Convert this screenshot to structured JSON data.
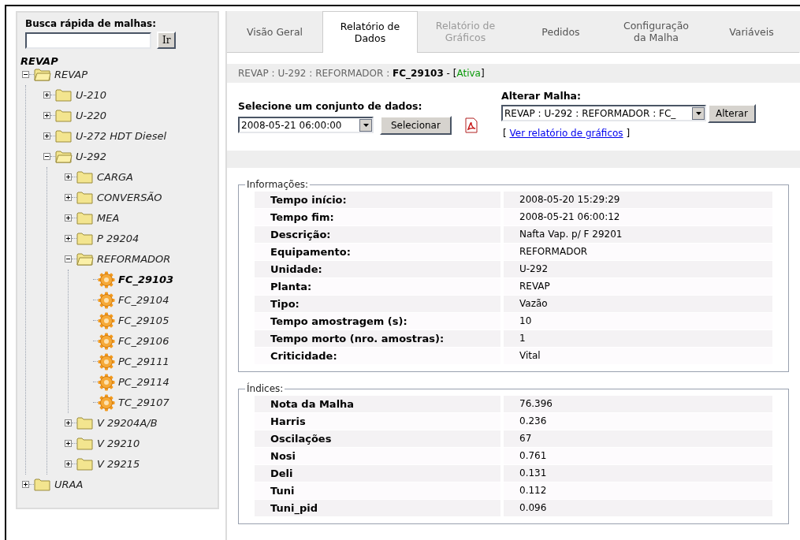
{
  "search": {
    "label": "Busca rápida de malhas:",
    "button": "Ir"
  },
  "tree": {
    "title": "REVAP",
    "items": [
      {
        "label": "REVAP",
        "kind": "folder",
        "expanded": true,
        "selected": false,
        "children": [
          {
            "label": "U-210",
            "kind": "folder",
            "expanded": false,
            "selected": false
          },
          {
            "label": "U-220",
            "kind": "folder",
            "expanded": false,
            "selected": false
          },
          {
            "label": "U-272 HDT Diesel",
            "kind": "folder",
            "expanded": false,
            "selected": false
          },
          {
            "label": "U-292",
            "kind": "folder",
            "expanded": true,
            "selected": false,
            "children": [
              {
                "label": "CARGA",
                "kind": "folder",
                "expanded": false,
                "selected": false
              },
              {
                "label": "CONVERSÃO",
                "kind": "folder",
                "expanded": false,
                "selected": false
              },
              {
                "label": "MEA",
                "kind": "folder",
                "expanded": false,
                "selected": false
              },
              {
                "label": "P 29204",
                "kind": "folder",
                "expanded": false,
                "selected": false
              },
              {
                "label": "REFORMADOR",
                "kind": "folder",
                "expanded": true,
                "selected": false,
                "children": [
                  {
                    "label": "FC_29103",
                    "kind": "loop",
                    "selected": true
                  },
                  {
                    "label": "FC_29104",
                    "kind": "loop",
                    "selected": false
                  },
                  {
                    "label": "FC_29105",
                    "kind": "loop",
                    "selected": false
                  },
                  {
                    "label": "FC_29106",
                    "kind": "loop",
                    "selected": false
                  },
                  {
                    "label": "PC_29111",
                    "kind": "loop",
                    "selected": false
                  },
                  {
                    "label": "PC_29114",
                    "kind": "loop",
                    "selected": false
                  },
                  {
                    "label": "TC_29107",
                    "kind": "loop",
                    "selected": false
                  }
                ]
              },
              {
                "label": "V 29204A/B",
                "kind": "folder",
                "expanded": false,
                "selected": false
              },
              {
                "label": "V 29210",
                "kind": "folder",
                "expanded": false,
                "selected": false
              },
              {
                "label": "V 29215",
                "kind": "folder",
                "expanded": false,
                "selected": false
              }
            ]
          }
        ]
      },
      {
        "label": "URAA",
        "kind": "folder",
        "expanded": false,
        "selected": false
      }
    ]
  },
  "tabs": [
    {
      "label": "Visão Geral",
      "selected": false,
      "disabled": false
    },
    {
      "label": "Relatório de Dados",
      "selected": true,
      "disabled": false
    },
    {
      "label": "Relatório de Gráficos",
      "selected": false,
      "disabled": true
    },
    {
      "label": "Pedidos",
      "selected": false,
      "disabled": false
    },
    {
      "label": "Configuração da Malha",
      "selected": false,
      "disabled": false
    },
    {
      "label": "Variáveis",
      "selected": false,
      "disabled": false
    }
  ],
  "breadcrumb": {
    "path": "REVAP : U-292 : REFORMADOR : ",
    "current": "FC_29103",
    "separator": " - ",
    "status_open": "[",
    "status": "Ativa",
    "status_close": "]"
  },
  "dataset": {
    "label": "Selecione um conjunto de dados:",
    "value": "2008-05-21 06:00:00",
    "button": "Selecionar"
  },
  "change_loop": {
    "label": "Alterar Malha:",
    "value": "REVAP : U-292 : REFORMADOR : FC_",
    "button": "Alterar",
    "link_open": "[ ",
    "link": "Ver relatório de gráficos",
    "link_close": " ]"
  },
  "info": {
    "legend": "Informações:",
    "rows": [
      {
        "label": "Tempo início:",
        "value": "2008-05-20 15:29:29"
      },
      {
        "label": "Tempo fim:",
        "value": "2008-05-21 06:00:12"
      },
      {
        "label": "Descrição:",
        "value": "Nafta Vap. p/ F 29201"
      },
      {
        "label": "Equipamento:",
        "value": "REFORMADOR"
      },
      {
        "label": "Unidade:",
        "value": "U-292"
      },
      {
        "label": "Planta:",
        "value": "REVAP"
      },
      {
        "label": "Tipo:",
        "value": "Vazão"
      },
      {
        "label": "Tempo amostragem (s):",
        "value": "10"
      },
      {
        "label": "Tempo morto (nro. amostras):",
        "value": "1"
      },
      {
        "label": "Criticidade:",
        "value": "Vital"
      }
    ]
  },
  "indices": {
    "legend": "Índices:",
    "rows": [
      {
        "label": "Nota da Malha",
        "value": "76.396"
      },
      {
        "label": "Harris",
        "value": "0.236"
      },
      {
        "label": "Oscilações",
        "value": "67"
      },
      {
        "label": "Nosi",
        "value": "0.761"
      },
      {
        "label": "Deli",
        "value": "0.131"
      },
      {
        "label": "Tuni",
        "value": "0.112"
      },
      {
        "label": "Tuni_pid",
        "value": "0.096"
      }
    ]
  }
}
